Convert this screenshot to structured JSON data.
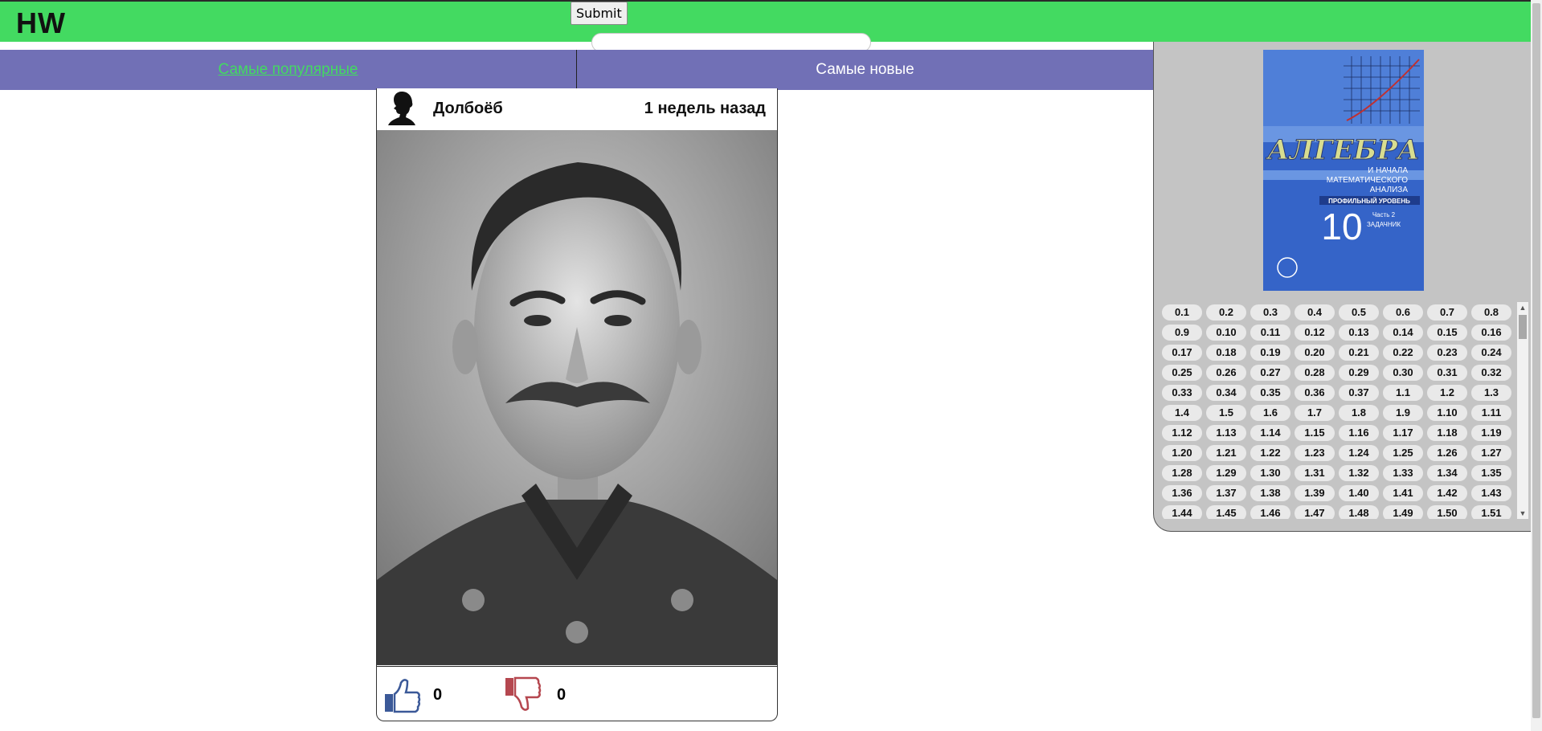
{
  "header": {
    "logo": "HW",
    "submit_label": "Submit",
    "search_value": ""
  },
  "tabs": [
    {
      "label": "Самые популярные",
      "active": true
    },
    {
      "label": "Самые новые",
      "active": false
    }
  ],
  "post": {
    "author": "Долбоёб",
    "time": "1 недель назад",
    "likes": "0",
    "dislikes": "0"
  },
  "book": {
    "title": "АЛГЕБРА",
    "subtitle_lines": [
      "И НАЧАЛА",
      "МАТЕМАТИЧЕСКОГО",
      "АНАЛИЗА"
    ],
    "level": "ПРОФИЛЬНЫЙ УРОВЕНЬ",
    "grade": "10",
    "part_lines": [
      "Часть 2",
      "ЗАДАЧНИК"
    ]
  },
  "tasks": [
    "0.1",
    "0.2",
    "0.3",
    "0.4",
    "0.5",
    "0.6",
    "0.7",
    "0.8",
    "0.9",
    "0.10",
    "0.11",
    "0.12",
    "0.13",
    "0.14",
    "0.15",
    "0.16",
    "0.17",
    "0.18",
    "0.19",
    "0.20",
    "0.21",
    "0.22",
    "0.23",
    "0.24",
    "0.25",
    "0.26",
    "0.27",
    "0.28",
    "0.29",
    "0.30",
    "0.31",
    "0.32",
    "0.33",
    "0.34",
    "0.35",
    "0.36",
    "0.37",
    "1.1",
    "1.2",
    "1.3",
    "1.4",
    "1.5",
    "1.6",
    "1.7",
    "1.8",
    "1.9",
    "1.10",
    "1.11",
    "1.12",
    "1.13",
    "1.14",
    "1.15",
    "1.16",
    "1.17",
    "1.18",
    "1.19",
    "1.20",
    "1.21",
    "1.22",
    "1.23",
    "1.24",
    "1.25",
    "1.26",
    "1.27",
    "1.28",
    "1.29",
    "1.30",
    "1.31",
    "1.32",
    "1.33",
    "1.34",
    "1.35",
    "1.36",
    "1.37",
    "1.38",
    "1.39",
    "1.40",
    "1.41",
    "1.42",
    "1.43",
    "1.44",
    "1.45",
    "1.46",
    "1.47",
    "1.48",
    "1.49",
    "1.50",
    "1.51"
  ],
  "colors": {
    "header_green": "#43da61",
    "tab_purple": "#7170b6",
    "panel_gray": "#c4c4c4"
  },
  "icons": {
    "like": "thumbs-up-icon",
    "dislike": "thumbs-down-icon",
    "avatar": "silhouette-icon"
  }
}
